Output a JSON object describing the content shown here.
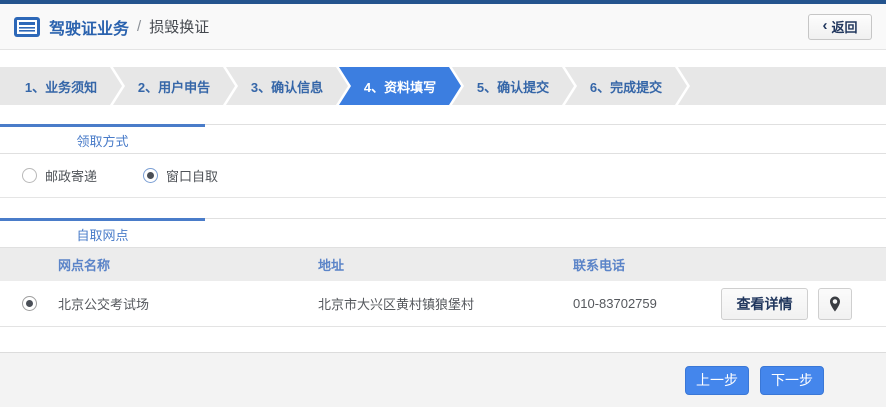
{
  "header": {
    "title": "驾驶证业务",
    "separator": "/",
    "subtitle": "损毁换证",
    "back_chevron": "‹",
    "back_label": "返回"
  },
  "steps": {
    "items": [
      {
        "label": "1、业务须知",
        "active": false
      },
      {
        "label": "2、用户申告",
        "active": false
      },
      {
        "label": "3、确认信息",
        "active": false
      },
      {
        "label": "4、资料填写",
        "active": true
      },
      {
        "label": "5、确认提交",
        "active": false
      },
      {
        "label": "6、完成提交",
        "active": false
      }
    ]
  },
  "pickup_method": {
    "section_title": "领取方式",
    "options": [
      {
        "label": "邮政寄递",
        "selected": false
      },
      {
        "label": "窗口自取",
        "selected": true
      }
    ]
  },
  "pickup_points": {
    "section_title": "自取网点",
    "columns": [
      "网点名称",
      "地址",
      "联系电话"
    ],
    "rows": [
      {
        "selected": true,
        "name": "北京公交考试场",
        "address": "北京市大兴区黄村镇狼堡村",
        "phone": "010-83702759",
        "detail_button": "查看详情"
      }
    ]
  },
  "footer": {
    "prev_button": "上一步",
    "next_button": "下一步"
  },
  "colors": {
    "top_bar": "#24548e",
    "accent_blue": "#3c7ee0",
    "tab_gray": "#e7e7e7",
    "section_label_blue": "#4a7cc9",
    "table_header_bg": "#ececec",
    "button_blue": "#4486ec"
  }
}
